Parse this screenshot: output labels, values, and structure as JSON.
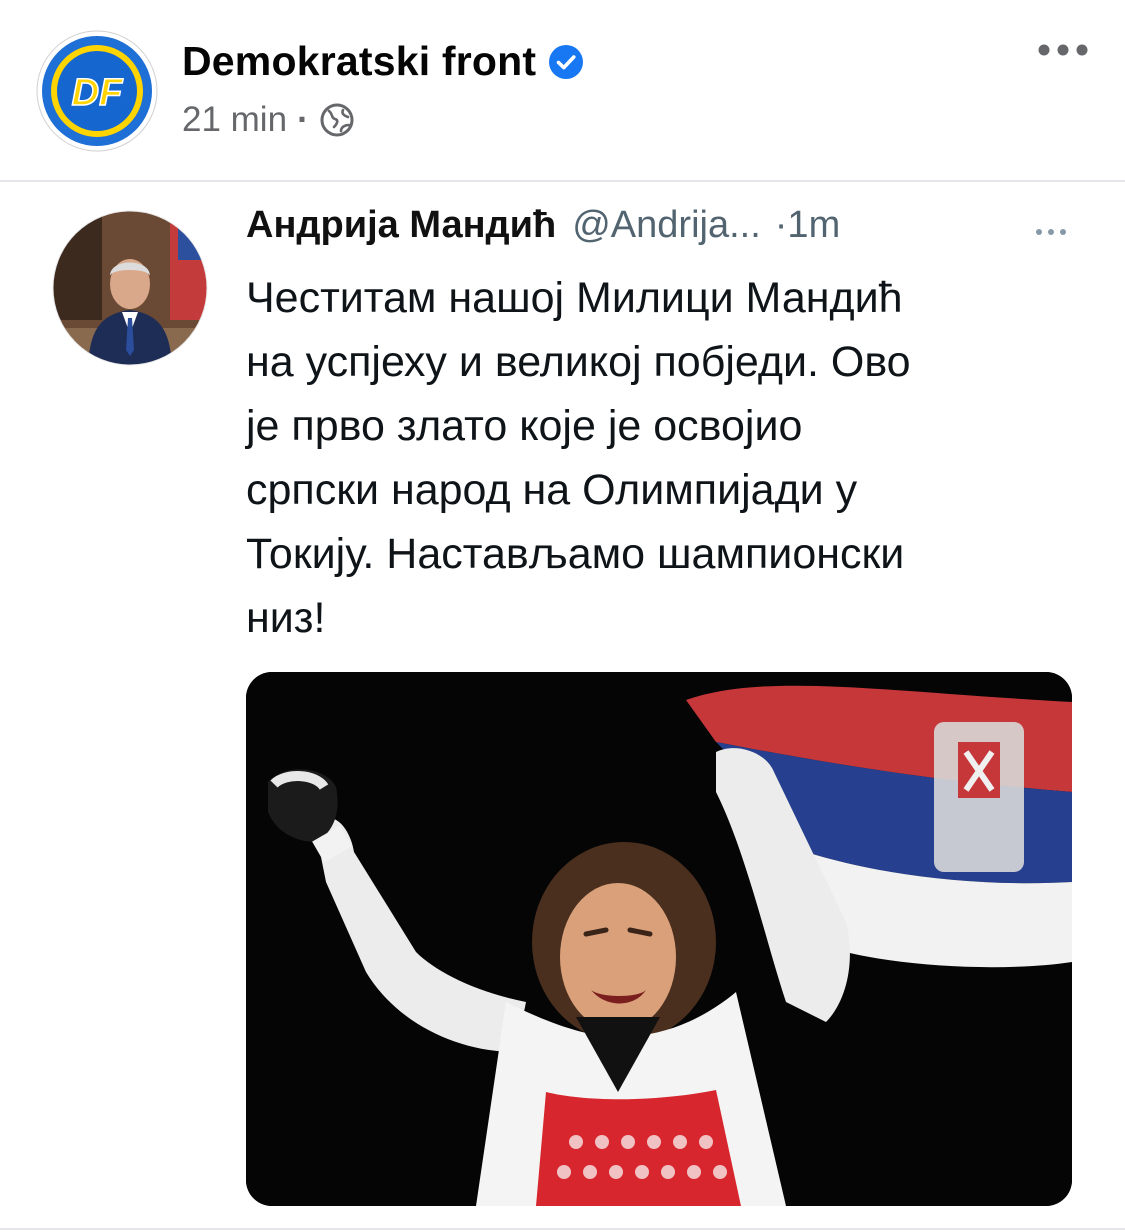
{
  "post": {
    "page_name": "Demokratski front",
    "page_logo_text": "DF",
    "time": "21 min",
    "separator": "·",
    "audience_icon": "globe-icon",
    "verified_icon": "verified-badge-icon",
    "more_icon": "more-horizontal-icon"
  },
  "tweet": {
    "author": "Андрија Мандић",
    "handle": "@Andrija...",
    "time": "·1m",
    "more_icon": "more-horizontal-icon",
    "text": "Честитам нашој Милици Мандић\nна успјеху и великој побједи. Ово\nје прво злато које је освојио\nсрпски народ на Олимпијади у\nТокију. Настављамо шампионски\nниз!"
  },
  "colors": {
    "facebook_blue": "#1877f2",
    "secondary_text": "#65676b",
    "logo_blue": "#1a73e8",
    "logo_yellow": "#ffd400"
  }
}
